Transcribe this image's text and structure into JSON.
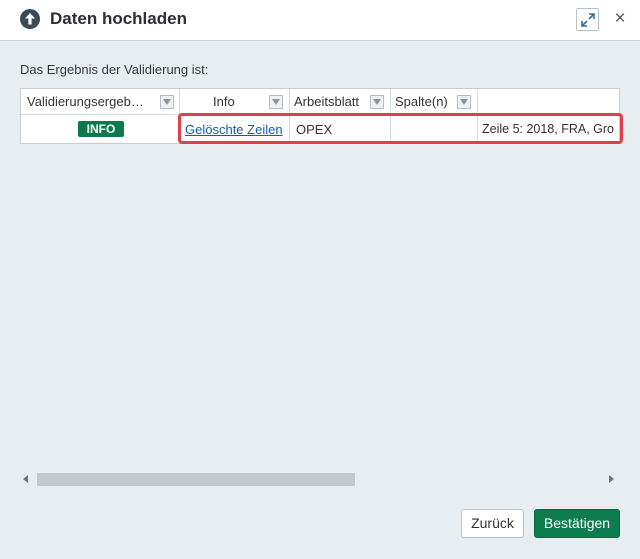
{
  "dialog": {
    "title": "Daten hochladen",
    "title_icon": "upload-arrow-icon",
    "maximize_icon": "maximize-icon",
    "close_symbol": "×"
  },
  "intro_text": "Das Ergebnis der Validierung ist:",
  "table": {
    "columns": [
      {
        "label": "Validierungsergeb…"
      },
      {
        "label": "Info"
      },
      {
        "label": "Arbeitsblatt"
      },
      {
        "label": "Spalte(n)"
      },
      {
        "label": ""
      }
    ],
    "rows": [
      {
        "result": "INFO",
        "info": "Gelöschte Zeilen",
        "sheet": "OPEX",
        "columns": "",
        "details": "Zeile 5: 2018, FRA, Gro"
      }
    ]
  },
  "buttons": {
    "back": "Zurück",
    "confirm": "Bestätigen"
  },
  "colors": {
    "info_badge": "#0d7a4e",
    "confirm_button": "#0e7c4e",
    "highlight": "#e0404a",
    "link": "#1a5aa8"
  }
}
